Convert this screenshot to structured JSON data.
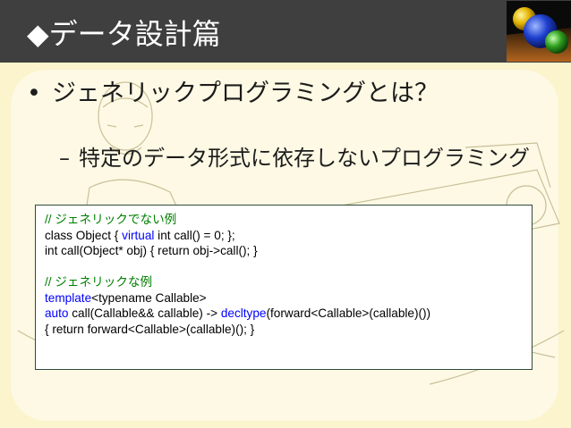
{
  "slide": {
    "title": "◆データ設計篇",
    "bullet_marker": "•",
    "bullet": "ジェネリックプログラミングとは？",
    "sub_marker": "–",
    "sub_bullet": "特定のデータ形式に依存しないプログラミング"
  },
  "code": {
    "line1": "// ジェネリックでない例",
    "line2_a": "class Object { ",
    "line2_kw": "virtual",
    "line2_b": " int call() = 0; };",
    "line3": "int call(Object* obj) { return obj->call(); }",
    "line5": "// ジェネリックな例",
    "line6_kw": "template",
    "line6_b": "<typename Callable>",
    "line7_kw1": "auto",
    "line7_b": " call(Callable&& callable) -> ",
    "line7_kw2": "decltype",
    "line7_c": "(forward<Callable>(callable)())",
    "line8": "{ return forward<Callable>(callable)(); }"
  },
  "colors": {
    "title_bar": "#3f3f3f",
    "background": "#fbf4cc",
    "comment": "#008000",
    "keyword": "#0000ff"
  }
}
